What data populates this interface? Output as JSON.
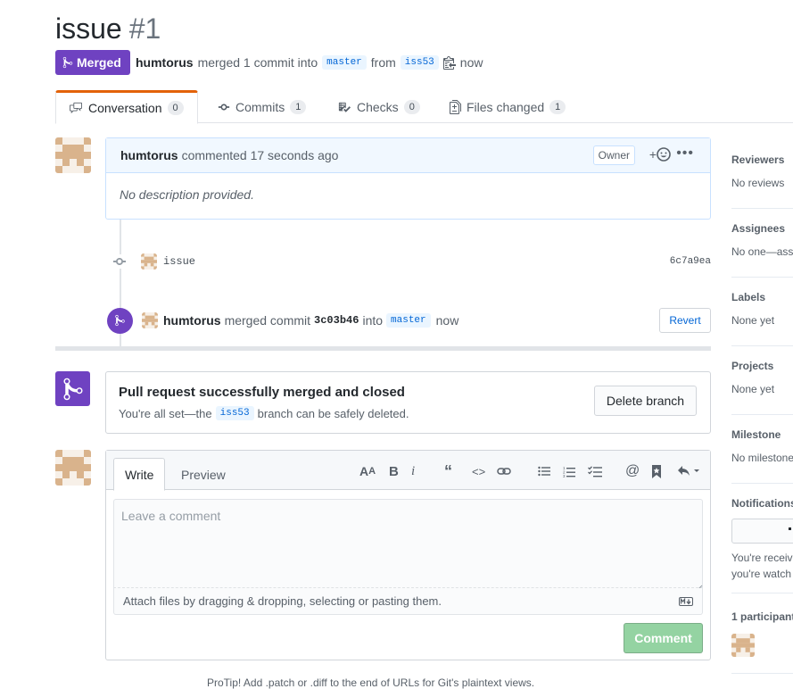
{
  "header": {
    "title": "issue",
    "number": "#1",
    "state": "Merged",
    "author": "humtorus",
    "merge_text": "merged 1 commit into",
    "base_ref": "master",
    "from_text": "from",
    "head_ref": "iss53",
    "time": "now"
  },
  "tabs": [
    {
      "label": "Conversation",
      "count": "0"
    },
    {
      "label": "Commits",
      "count": "1"
    },
    {
      "label": "Checks",
      "count": "0"
    },
    {
      "label": "Files changed",
      "count": "1"
    }
  ],
  "comment": {
    "author": "humtorus",
    "action": "commented 17 seconds ago",
    "role_label": "Owner",
    "body": "No description provided."
  },
  "commit": {
    "message": "issue",
    "sha": "6c7a9ea"
  },
  "merge_event": {
    "author": "humtorus",
    "text1": "merged commit",
    "sha": "3c03b46",
    "text2": "into",
    "ref": "master",
    "time": "now",
    "revert_label": "Revert"
  },
  "merge_status": {
    "title": "Pull request successfully merged and closed",
    "desc_before": "You're all set—the",
    "branch": "iss53",
    "desc_after": "branch can be safely deleted.",
    "delete_label": "Delete branch"
  },
  "editor": {
    "write_tab": "Write",
    "preview_tab": "Preview",
    "placeholder": "Leave a comment",
    "attach_text": "Attach files by dragging & dropping, selecting or pasting them.",
    "submit_label": "Comment"
  },
  "sidebar": {
    "reviewers": {
      "label": "Reviewers",
      "value": "No reviews"
    },
    "assignees": {
      "label": "Assignees",
      "value": "No one—ass"
    },
    "labels": {
      "label": "Labels",
      "value": "None yet"
    },
    "projects": {
      "label": "Projects",
      "value": "None yet"
    },
    "milestone": {
      "label": "Milestone",
      "value": "No milestone"
    },
    "notifications": {
      "label": "Notifications",
      "line1": "You're receivi",
      "line2": "you're watch"
    },
    "participants": {
      "label": "1 participant"
    }
  },
  "footer_cutoff": "ProTip! Add .patch or .diff to the end of URLs for Git's plaintext views.",
  "colors": {
    "merged_purple": "#6f42c1",
    "link_blue": "#0366d6",
    "comment_border": "#c8e1ff",
    "comment_head_bg": "#f1f8ff",
    "tab_accent": "#e36209",
    "disabled_green": "#94d3a2"
  }
}
